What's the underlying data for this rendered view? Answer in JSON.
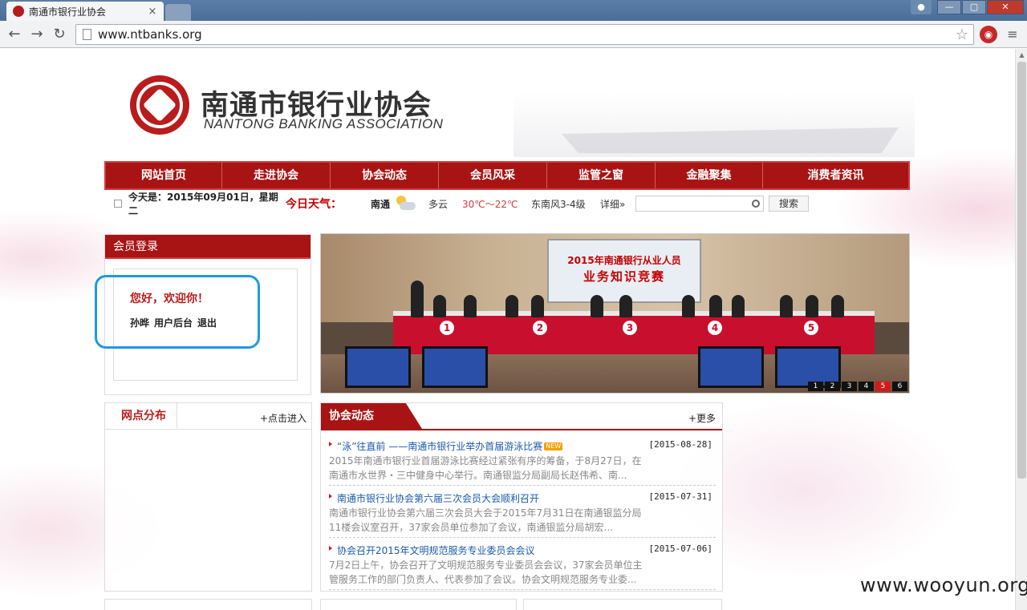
{
  "browser": {
    "tab_title": "南通市银行业协会",
    "tab_close": "×",
    "url": "www.ntbanks.org",
    "window_controls": [
      "minimize",
      "maximize",
      "close"
    ]
  },
  "site": {
    "logo_cn": "南通市银行业协会",
    "logo_en": "NANTONG BANKING ASSOCIATION",
    "brand_color": "#a81414"
  },
  "nav": {
    "items": [
      "网站首页",
      "走进协会",
      "协会动态",
      "会员风采",
      "监管之窗",
      "金融聚集",
      "消费者资讯"
    ]
  },
  "infobar": {
    "date": "今天是：2015年09月01日，星期二",
    "weather_title": "今日天气：",
    "city": "南通",
    "condition": "多云",
    "temperature": "30℃～22℃",
    "wind": "东南风3-4级",
    "details": "详细»",
    "search_placeholder": "",
    "search_button": "搜索"
  },
  "login": {
    "title": "会员登录",
    "greeting": "您好，欢迎你！",
    "username": "孙晔",
    "backend": "用户后台",
    "logout": "退出"
  },
  "slider": {
    "screen_line1": "2015年南通银行从业人员",
    "screen_line2": "业务知识竞赛",
    "badges": [
      "1",
      "2",
      "3",
      "4",
      "5"
    ],
    "pages": [
      "1",
      "2",
      "3",
      "4",
      "5",
      "6"
    ],
    "active_page": "5"
  },
  "outlets": {
    "title": "网点分布",
    "more": "+点击进入"
  },
  "news": {
    "title": "协会动态",
    "more": "+更多",
    "items": [
      {
        "title": "“泳”往直前 ——南通市银行业举办首届游泳比赛",
        "new_badge": "NEW",
        "date": "[2015-08-28]",
        "summary": "2015年南通市银行业首届游泳比赛经过紧张有序的筹备，于8月27日，在南通市水世界・三中健身中心举行。南通银监分局副局长赵伟希、南..."
      },
      {
        "title": "南通市银行业协会第六届三次会员大会顺利召开",
        "new_badge": "",
        "date": "[2015-07-31]",
        "summary": "南通市银行业协会第六届三次会员大会于2015年7月31日在南通银监分局11楼会议室召开，37家会员单位参加了会议，南通银监分局胡宏..."
      },
      {
        "title": "协会召开2015年文明规范服务专业委员会会议",
        "new_badge": "",
        "date": "[2015-07-06]",
        "summary": "7月2日上午，协会召开了文明规范服务专业委员会会议，37家会员单位主管服务工作的部门负责人、代表参加了会议。协会文明规范服务专业委..."
      }
    ]
  },
  "watermark": "www.wooyun.org",
  "colors": {
    "accent": "#a81414",
    "link": "#1a5aa8",
    "highlight_ring": "#1e9be0"
  },
  "icons": {
    "back": "←",
    "forward": "→",
    "reload": "↻",
    "star": "☆",
    "menu": "≡",
    "ext": "◉"
  }
}
